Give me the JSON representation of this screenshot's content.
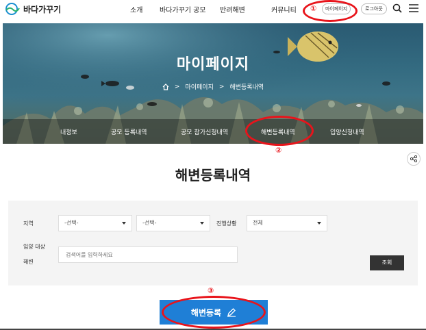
{
  "header": {
    "logo_text": "바다가꾸기",
    "nav": [
      "소개",
      "바다가꾸기 공모",
      "반려해변",
      "커뮤니티"
    ],
    "mypage_label": "마이페이지",
    "logout_label": "로그아웃",
    "icons": {
      "search": "search-icon",
      "menu": "hamburger-menu-icon"
    }
  },
  "banner": {
    "title": "마이페이지",
    "breadcrumb": [
      "마이페이지",
      "해변등록내역"
    ],
    "tabs": [
      "내정보",
      "공모 등록내역",
      "공모 참가신청내역",
      "해변등록내역",
      "입양신청내역"
    ],
    "active_tab": "해변등록내역"
  },
  "annotations": [
    "①",
    "②",
    "③"
  ],
  "annotation_color": "#e8141b",
  "main": {
    "page_title": "해변등록내역",
    "filter": {
      "region_label": "지역",
      "region_select_1": "-선택-",
      "region_select_2": "-선택-",
      "status_label": "진행상황",
      "status_select": "전체",
      "target_label_line1": "입양 대상",
      "target_label_line2": "해변",
      "search_placeholder": "검색어를 입력하세요",
      "query_button": "조회"
    },
    "register_button": "해변등록",
    "accent_color": "#1f7fd6"
  }
}
